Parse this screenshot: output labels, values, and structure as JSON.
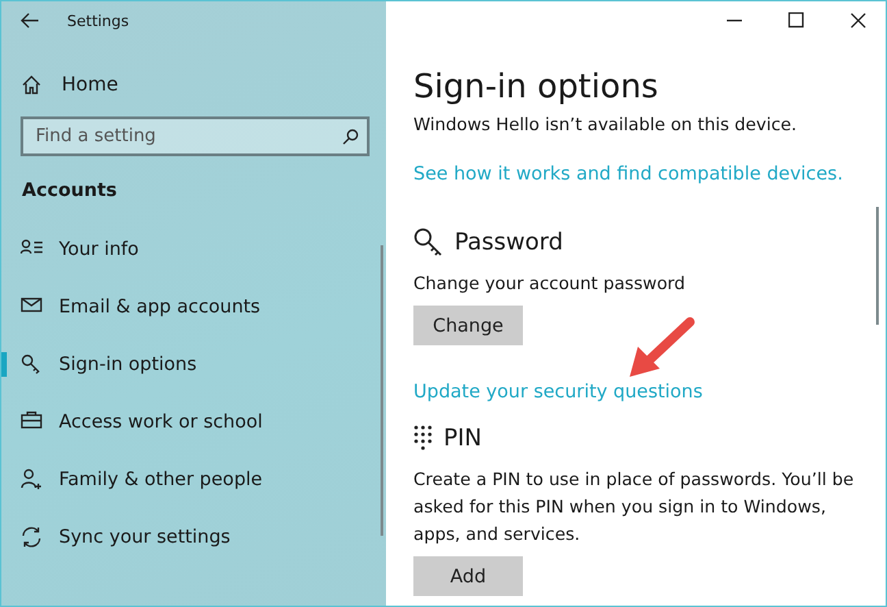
{
  "window": {
    "title": "Settings"
  },
  "sidebar": {
    "home": "Home",
    "search": {
      "placeholder": "Find a setting"
    },
    "heading": "Accounts",
    "items": [
      {
        "label": "Your info",
        "selected": false
      },
      {
        "label": "Email & app accounts",
        "selected": false
      },
      {
        "label": "Sign-in options",
        "selected": true
      },
      {
        "label": "Access work or school",
        "selected": false
      },
      {
        "label": "Family & other people",
        "selected": false
      },
      {
        "label": "Sync your settings",
        "selected": false
      }
    ]
  },
  "page": {
    "title": "Sign-in options",
    "note": "Windows Hello isn’t available on this device.",
    "link": "See how it works and find compatible devices.",
    "sections": [
      {
        "kind": "password",
        "title": "Password",
        "description": "Change your account password",
        "button": "Change",
        "link": "Update your security questions"
      },
      {
        "kind": "pin",
        "title": "PIN",
        "description": "Create a PIN to use in place of passwords. You’ll be asked for this PIN when you sign in to Windows, apps, and services.",
        "button": "Add"
      }
    ]
  }
}
